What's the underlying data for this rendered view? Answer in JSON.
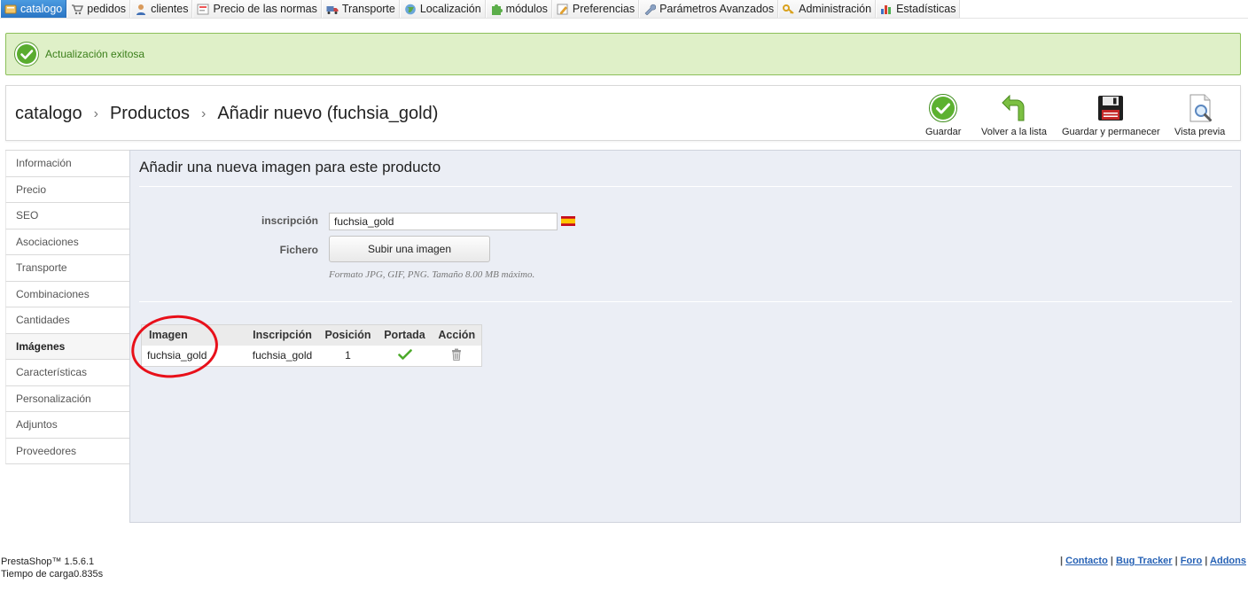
{
  "menu": [
    {
      "label": "catalogo",
      "icon": "catalog-icon",
      "active": true
    },
    {
      "label": "pedidos",
      "icon": "cart-icon"
    },
    {
      "label": "clientes",
      "icon": "customer-icon"
    },
    {
      "label": "Precio de las normas",
      "icon": "price-rules-icon"
    },
    {
      "label": "Transporte",
      "icon": "truck-icon"
    },
    {
      "label": "Localización",
      "icon": "globe-icon"
    },
    {
      "label": "módulos",
      "icon": "puzzle-icon"
    },
    {
      "label": "Preferencias",
      "icon": "preferences-icon"
    },
    {
      "label": "Parámetros Avanzados",
      "icon": "wrench-icon"
    },
    {
      "label": "Administración",
      "icon": "key-icon"
    },
    {
      "label": "Estadísticas",
      "icon": "stats-icon"
    }
  ],
  "confirmation": {
    "message": "Actualización exitosa"
  },
  "breadcrumb": {
    "items": [
      "catalogo",
      "Productos",
      "Añadir nuevo (fuchsia_gold)"
    ],
    "separator": "›"
  },
  "toolbar": {
    "save": "Guardar",
    "back": "Volver a la lista",
    "save_stay": "Guardar y permanecer",
    "preview": "Vista previa"
  },
  "tabs": [
    {
      "label": "Información"
    },
    {
      "label": "Precio"
    },
    {
      "label": "SEO"
    },
    {
      "label": "Asociaciones"
    },
    {
      "label": "Transporte"
    },
    {
      "label": "Combinaciones"
    },
    {
      "label": "Cantidades"
    },
    {
      "label": "Imágenes",
      "active": true
    },
    {
      "label": "Características"
    },
    {
      "label": "Personalización"
    },
    {
      "label": "Adjuntos"
    },
    {
      "label": "Proveedores"
    }
  ],
  "panel": {
    "title": "Añadir una nueva imagen para este producto",
    "inscription_label": "inscripción",
    "inscription_value": "fuchsia_gold",
    "file_label": "Fichero",
    "upload_label": "Subir una imagen",
    "hint": "Formato JPG, GIF, PNG. Tamaño 8.00 MB máximo."
  },
  "image_table": {
    "headers": [
      "Imagen",
      "Inscripción",
      "Posición",
      "Portada",
      "Acción"
    ],
    "rows": [
      {
        "image": "fuchsia_gold",
        "inscription": "fuchsia_gold",
        "position": "1"
      }
    ]
  },
  "footer": {
    "version": "PrestaShop™ 1.5.6.1",
    "load_time": "Tiempo de carga0.835s",
    "links": [
      "Contacto",
      "Bug Tracker",
      "Foro",
      "Addons"
    ]
  },
  "colors": {
    "accent": "#2a75c4",
    "success_bg": "#dff0c8",
    "success_text": "#3b7f1a",
    "link": "#2762b5",
    "highlight": "#e8101a"
  }
}
